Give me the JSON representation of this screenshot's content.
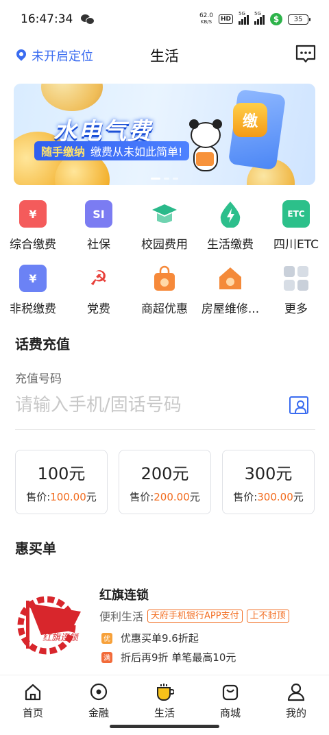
{
  "status_bar": {
    "time": "16:47:34",
    "net_speed": "62.0",
    "net_unit": "KB/S",
    "hd": "HD",
    "signal1": "5G",
    "signal2": "5G",
    "battery": "35"
  },
  "header": {
    "location": "未开启定位",
    "title": "生活"
  },
  "banner": {
    "title": "水电气费",
    "sub_highlight": "随手缴纳",
    "sub_text": "缴费从未如此简单!",
    "badge": "缴"
  },
  "grid": [
    {
      "label": "综合缴费",
      "icon": "composite-payment-icon",
      "color": "#f45b5b",
      "glyph": "¥"
    },
    {
      "label": "社保",
      "icon": "social-security-icon",
      "color": "#7b7cf2",
      "glyph": "SI"
    },
    {
      "label": "校园费用",
      "icon": "graduation-cap-icon",
      "color": "#2ab98a",
      "glyph": ""
    },
    {
      "label": "生活缴费",
      "icon": "water-drop-icon",
      "color": "#2dbf8c",
      "glyph": "ϟ"
    },
    {
      "label": "四川ETC",
      "icon": "etc-card-icon",
      "color": "#2cc08a",
      "glyph": "ETC"
    },
    {
      "label": "非税缴费",
      "icon": "non-tax-icon",
      "color": "#6b82f5",
      "glyph": "¥"
    },
    {
      "label": "党费",
      "icon": "party-emblem-icon",
      "color": "#e8403a",
      "glyph": "☭"
    },
    {
      "label": "商超优惠",
      "icon": "shopping-bag-icon",
      "color": "#f6893a",
      "glyph": "¥"
    },
    {
      "label": "房屋维修...",
      "icon": "house-icon",
      "color": "#f48a3a",
      "glyph": "¥"
    },
    {
      "label": "更多",
      "icon": "more-grid-icon",
      "color": "#c9d0da",
      "glyph": ""
    }
  ],
  "recharge": {
    "section_title": "话费充值",
    "field_label": "充值号码",
    "placeholder": "请输入手机/固话号码",
    "amounts": [
      {
        "value": "100元",
        "price_label": "售价:",
        "price": "100.00",
        "unit": "元"
      },
      {
        "value": "200元",
        "price_label": "售价:",
        "price": "200.00",
        "unit": "元"
      },
      {
        "value": "300元",
        "price_label": "售价:",
        "price": "300.00",
        "unit": "元"
      }
    ]
  },
  "deals": {
    "section_title": "惠买单",
    "merchant": {
      "name": "红旗连锁",
      "category": "便利生活",
      "tag1": "天府手机银行APP支付",
      "tag2": "上不封顶",
      "line1_badge": "优",
      "line1": "优惠买单9.6折起",
      "line2_badge": "满",
      "line2": "折后再9折 单笔最高10元",
      "logo_text": "红旗连锁"
    }
  },
  "bottom_nav": [
    {
      "label": "首页",
      "icon": "home-icon"
    },
    {
      "label": "金融",
      "icon": "finance-icon"
    },
    {
      "label": "生活",
      "icon": "life-cup-icon"
    },
    {
      "label": "商城",
      "icon": "mall-bag-icon"
    },
    {
      "label": "我的",
      "icon": "profile-icon"
    }
  ],
  "colors": {
    "accent": "#3a6cf0",
    "price": "#f26b1d"
  }
}
